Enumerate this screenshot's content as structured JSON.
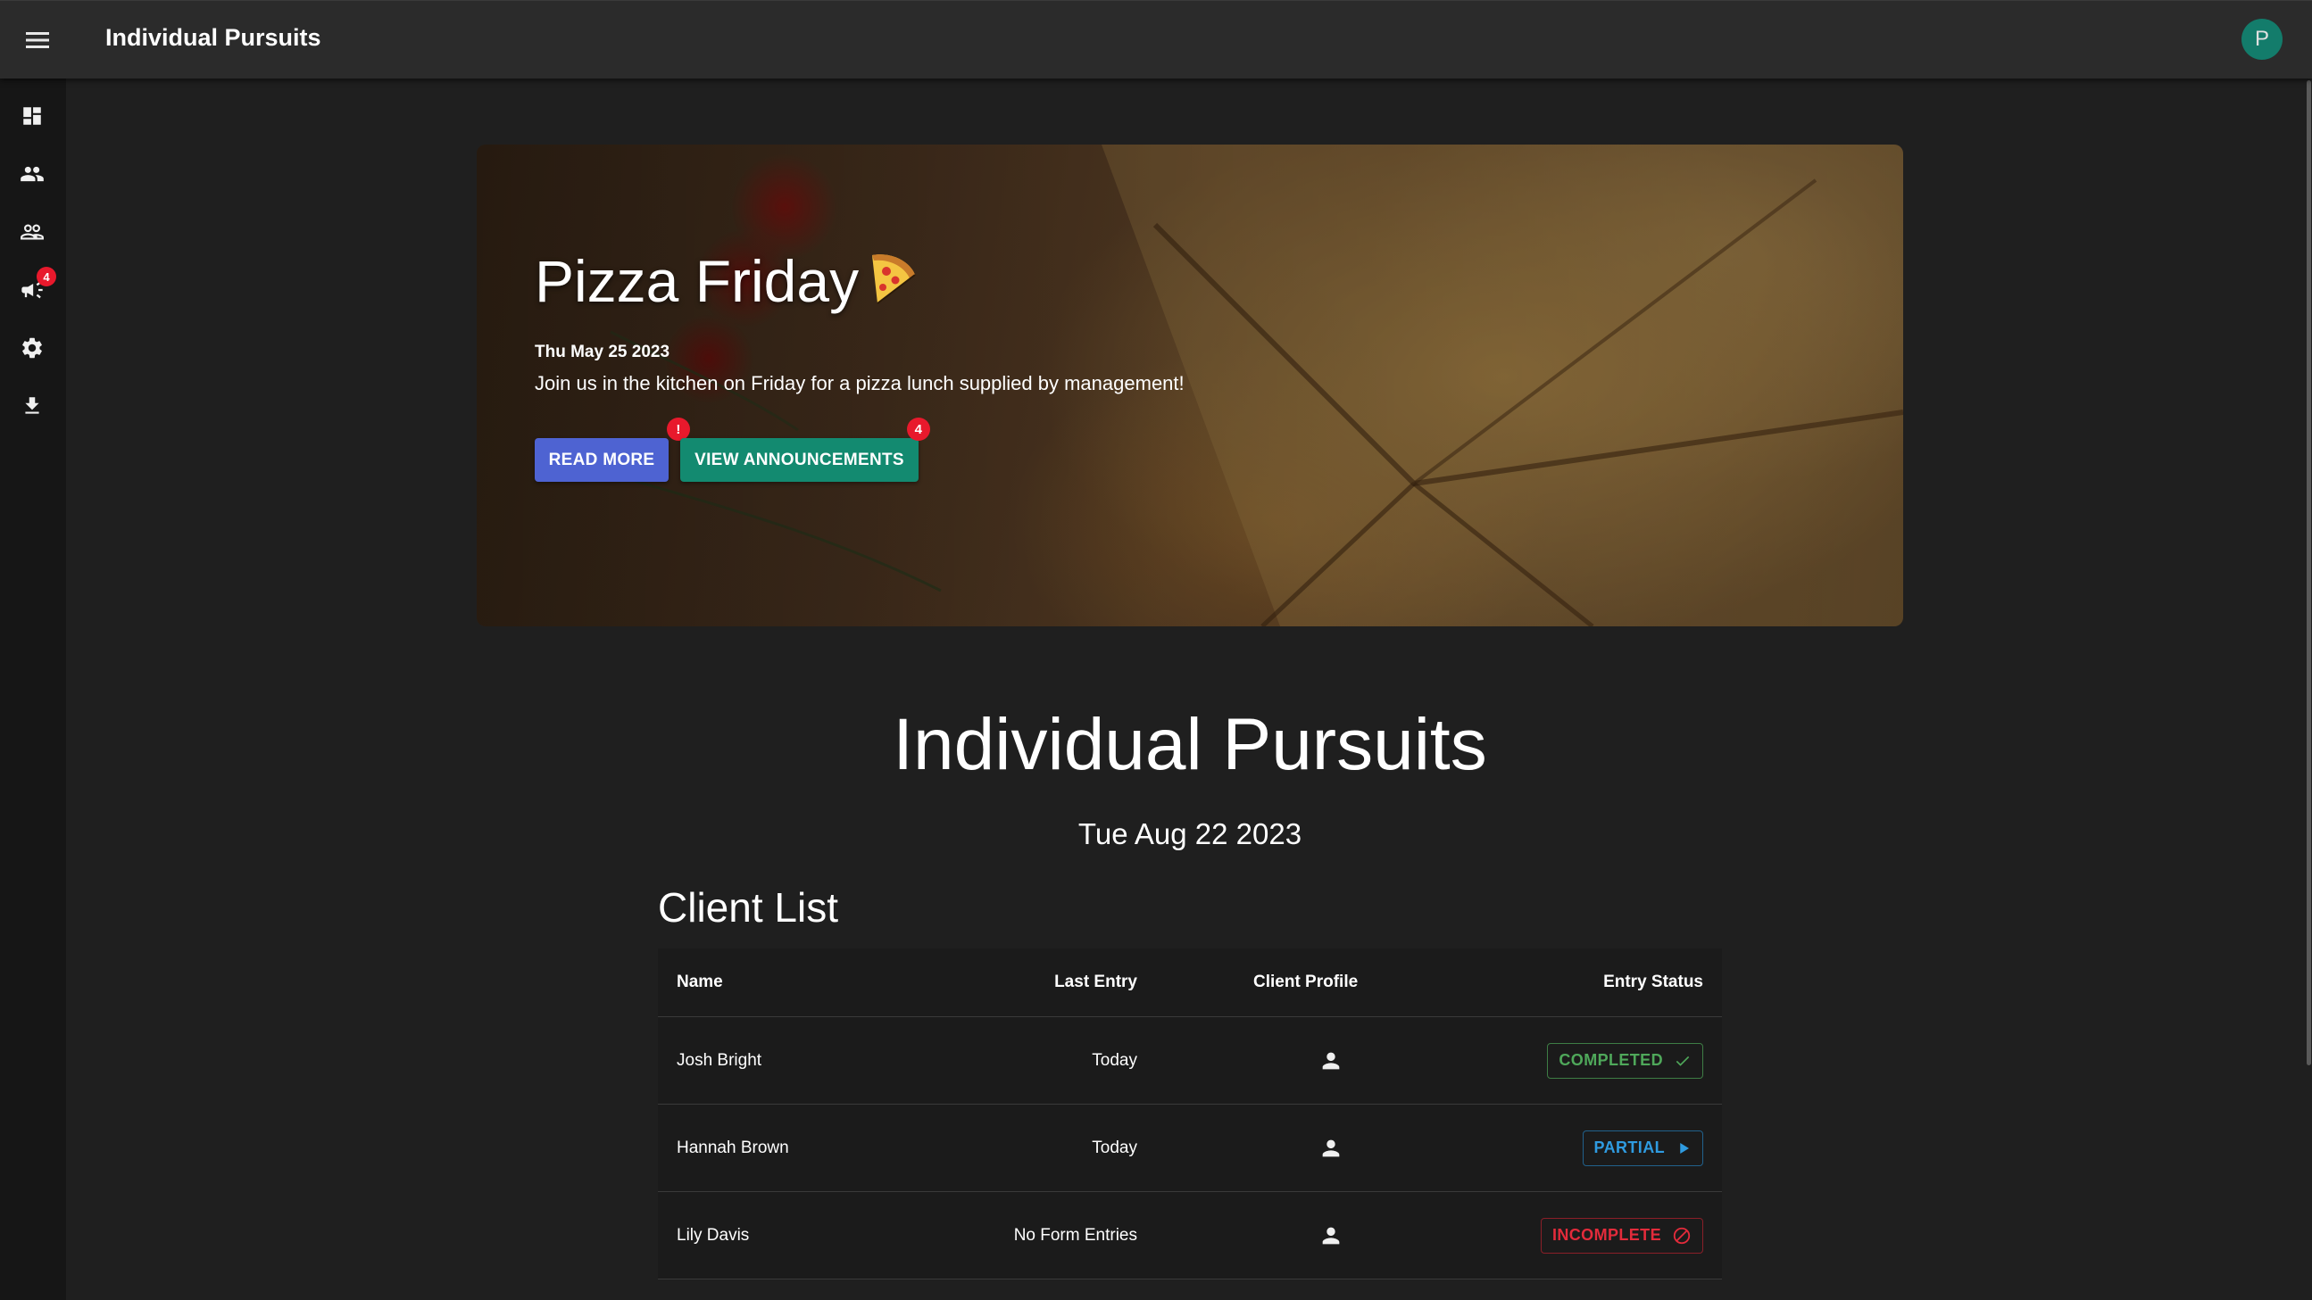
{
  "appbar": {
    "title": "Individual Pursuits",
    "avatar_initial": "P"
  },
  "sidebar": {
    "items": [
      {
        "name": "dashboard",
        "icon": "dashboard-icon"
      },
      {
        "name": "people",
        "icon": "people-icon"
      },
      {
        "name": "groups",
        "icon": "groups-outline-icon"
      },
      {
        "name": "announcements",
        "icon": "campaign-icon",
        "badge": "4"
      },
      {
        "name": "settings",
        "icon": "gear-icon"
      },
      {
        "name": "download",
        "icon": "download-icon"
      }
    ]
  },
  "hero": {
    "title": "Pizza Friday",
    "emoji": "pizza-icon",
    "date": "Thu May 25 2023",
    "text": "Join us in the kitchen on Friday for a pizza lunch supplied by management!",
    "read_more_label": "READ MORE",
    "read_more_badge": "!",
    "view_label": "VIEW ANNOUNCEMENTS",
    "view_badge": "4"
  },
  "main": {
    "heading": "Individual Pursuits",
    "date": "Tue Aug 22 2023",
    "client_list_title": "Client List"
  },
  "table": {
    "headers": {
      "name": "Name",
      "last_entry": "Last Entry",
      "client_profile": "Client Profile",
      "entry_status": "Entry Status"
    },
    "rows": [
      {
        "name": "Josh Bright",
        "last_entry": "Today",
        "status": "COMPLETED",
        "status_icon": "check-icon"
      },
      {
        "name": "Hannah Brown",
        "last_entry": "Today",
        "status": "PARTIAL",
        "status_icon": "play-arrow-icon"
      },
      {
        "name": "Lily Davis",
        "last_entry": "No Form Entries",
        "status": "INCOMPLETE",
        "status_icon": "block-icon"
      }
    ]
  },
  "colors": {
    "appbar": "#2b2b2b",
    "background": "#1f1f1f",
    "sidebar": "#161616",
    "read_more": "#4e63d2",
    "view_announcements": "#138a70",
    "badge": "#e8192c",
    "completed": "#4fa85a",
    "partial": "#2f9be0",
    "incomplete": "#e32b3b",
    "avatar": "#137c6b"
  }
}
